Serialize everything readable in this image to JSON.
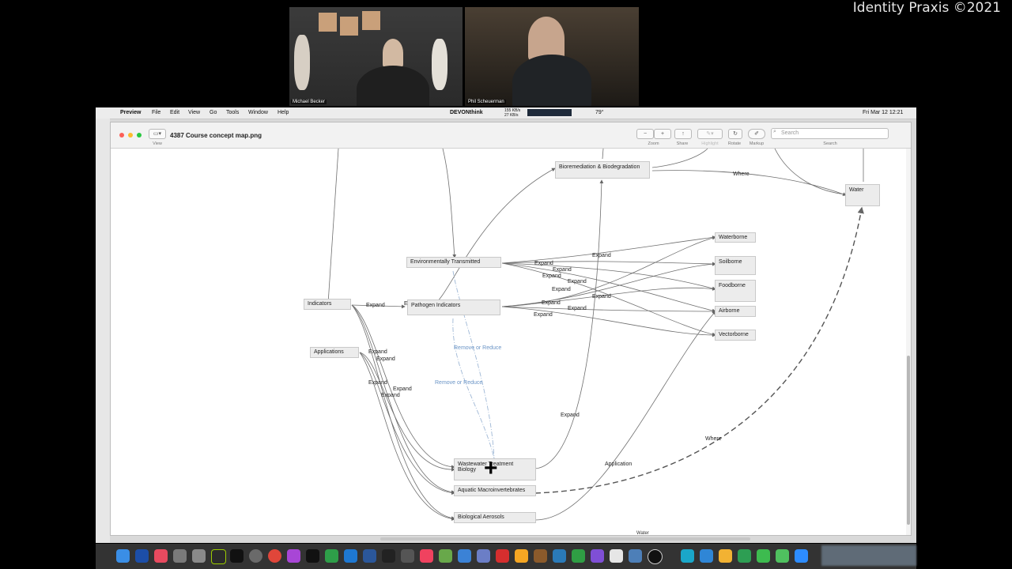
{
  "watermark": "Identity Praxis ©2021",
  "video": {
    "left_name": "Michael Becker",
    "right_name": "Phil Scheuerman"
  },
  "menubar": {
    "app": "Preview",
    "items": [
      "File",
      "Edit",
      "View",
      "Go",
      "Tools",
      "Window",
      "Help"
    ],
    "devonthink": "DEVONthink",
    "network_up": "155 KB/s",
    "network_down": "27 KB/s",
    "temperature": "79°",
    "clock": "Fri Mar 12  12:21"
  },
  "window": {
    "title": "4387 Course concept map.png",
    "view_label": "View",
    "toolbar_labels": [
      "Zoom",
      "Share",
      "Highlight",
      "Rotate",
      "Markup"
    ],
    "search_placeholder": "Search",
    "search_label": "Search"
  },
  "nodes": {
    "bioremediation": "Bioremediation & Biodegradation",
    "water": "Water",
    "waterborne": "Waterborne",
    "soilborne": "Soilborne",
    "foodborne": "Foodborne",
    "airborne": "Airborne",
    "vectorborne": "Vectorborne",
    "env_transmitted": "Environmentally Transmitted",
    "pathogen_indicators": "Pathogen Indicators",
    "indicators": "Indicators",
    "applications": "Applications",
    "wastewater": "Wastewater Treatment Biology",
    "aquatic": "Aquatic Macroinvertebrates",
    "aerosols": "Biological Aerosols"
  },
  "edge_labels": {
    "where": "Where",
    "expand": "Expand",
    "remove_or_reduce": "Remove or Reduce",
    "application": "Application",
    "pathogen_prefix": "E"
  },
  "bottom_fragment": "Water"
}
